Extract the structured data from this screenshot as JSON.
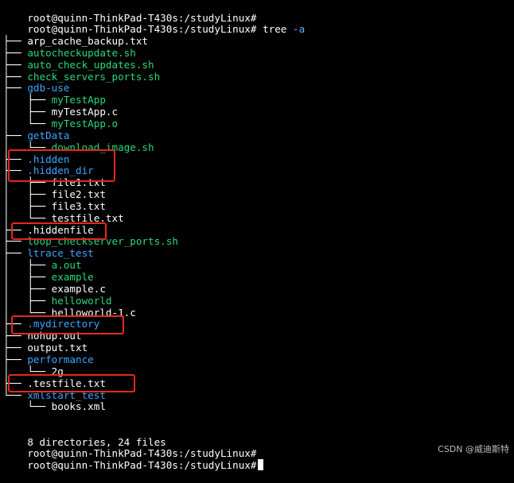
{
  "terminal": {
    "prompt": "root@quinn-ThinkPad-T430s:/studyLinux#",
    "command_name": "tree",
    "command_arg": "-a",
    "root_dot": ".",
    "entries": [
      {
        "prefix": "├── ",
        "name": "arp_cache_backup.txt",
        "color": "#ffffff"
      },
      {
        "prefix": "├── ",
        "name": "autocheckupdate.sh",
        "color": "#2bd97a"
      },
      {
        "prefix": "├── ",
        "name": "auto_check_updates.sh",
        "color": "#2bd97a"
      },
      {
        "prefix": "├── ",
        "name": "check_servers_ports.sh",
        "color": "#2bd97a"
      },
      {
        "prefix": "├── ",
        "name": "gdb-use",
        "color": "#3ba7ff"
      },
      {
        "prefix": "│   ├── ",
        "name": "myTestApp",
        "color": "#2bd97a"
      },
      {
        "prefix": "│   ├── ",
        "name": "myTestApp.c",
        "color": "#ffffff"
      },
      {
        "prefix": "│   └── ",
        "name": "myTestApp.o",
        "color": "#2bd97a"
      },
      {
        "prefix": "├── ",
        "name": "getData",
        "color": "#3ba7ff"
      },
      {
        "prefix": "│   └── ",
        "name": "download_image.sh",
        "color": "#2bd97a"
      },
      {
        "prefix": "├── ",
        "name": ".hidden",
        "color": "#3ba7ff"
      },
      {
        "prefix": "├── ",
        "name": ".hidden_dir",
        "color": "#3ba7ff"
      },
      {
        "prefix": "│   ├── ",
        "name": "file1.txt",
        "color": "#ffffff"
      },
      {
        "prefix": "│   ├── ",
        "name": "file2.txt",
        "color": "#ffffff"
      },
      {
        "prefix": "│   ├── ",
        "name": "file3.txt",
        "color": "#ffffff"
      },
      {
        "prefix": "│   └── ",
        "name": "testfile.txt",
        "color": "#ffffff"
      },
      {
        "prefix": "├── ",
        "name": ".hiddenfile",
        "color": "#ffffff"
      },
      {
        "prefix": "├── ",
        "name": "loop_checkserver_ports.sh",
        "color": "#2bd97a"
      },
      {
        "prefix": "├── ",
        "name": "ltrace_test",
        "color": "#3ba7ff"
      },
      {
        "prefix": "│   ├── ",
        "name": "a.out",
        "color": "#2bd97a"
      },
      {
        "prefix": "│   ├── ",
        "name": "example",
        "color": "#2bd97a"
      },
      {
        "prefix": "│   ├── ",
        "name": "example.c",
        "color": "#ffffff"
      },
      {
        "prefix": "│   ├── ",
        "name": "helloworld",
        "color": "#2bd97a"
      },
      {
        "prefix": "│   └── ",
        "name": "helloworld-1.c",
        "color": "#ffffff"
      },
      {
        "prefix": "├── ",
        "name": ".mydirectory",
        "color": "#3ba7ff"
      },
      {
        "prefix": "├── ",
        "name": "nohup.out",
        "color": "#ffffff"
      },
      {
        "prefix": "├── ",
        "name": "output.txt",
        "color": "#ffffff"
      },
      {
        "prefix": "├── ",
        "name": "performance",
        "color": "#3ba7ff"
      },
      {
        "prefix": "│   └── ",
        "name": "2g",
        "color": "#ffffff"
      },
      {
        "prefix": "├── ",
        "name": ".testfile.txt",
        "color": "#ffffff"
      },
      {
        "prefix": "└── ",
        "name": "xmlstart_test",
        "color": "#3ba7ff"
      },
      {
        "prefix": "    └── ",
        "name": "books.xml",
        "color": "#ffffff"
      }
    ],
    "summary": "8 directories, 24 files",
    "highlighted_entries": [
      ".hidden",
      ".hidden_dir",
      ".hiddenfile",
      ".mydirectory",
      ".testfile.txt"
    ],
    "highlight_color": "#e8271f"
  },
  "watermark": "CSDN @威迪斯特"
}
